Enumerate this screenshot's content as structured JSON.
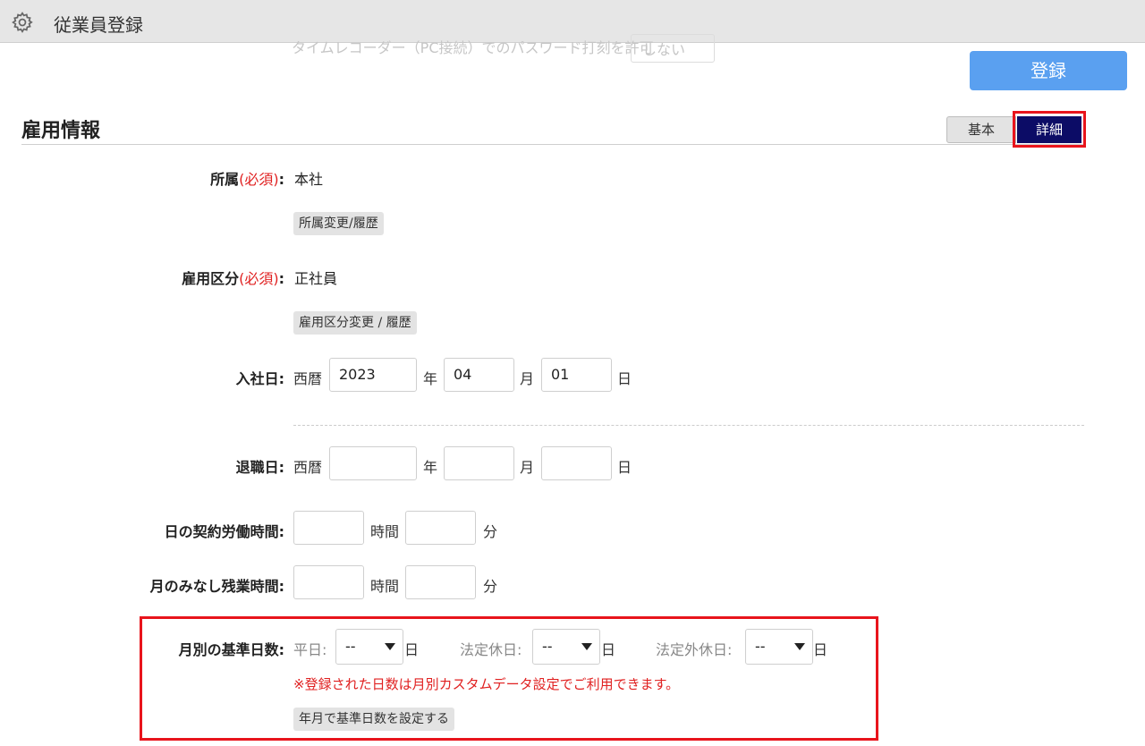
{
  "header": {
    "title": "従業員登録",
    "icon": "gear-icon"
  },
  "ghost_row": {
    "label": "タイムレコーダー（PC接続）でのパスワード打刻を許可",
    "value": "しない"
  },
  "toolbar": {
    "register_label": "登録"
  },
  "section": {
    "title": "雇用情報"
  },
  "view_toggle": {
    "basic": "基本",
    "detail": "詳細",
    "active": "detail"
  },
  "fields": {
    "affiliation": {
      "label": "所属",
      "required": "(必須)",
      "colon": ":",
      "value": "本社",
      "button": "所属変更/履歴"
    },
    "employment_type": {
      "label": "雇用区分",
      "required": "(必須)",
      "colon": ":",
      "value": "正社員",
      "button": "雇用区分変更 / 履歴"
    },
    "hire_date": {
      "label": "入社日:",
      "era": "西暦",
      "year": "2023",
      "year_unit": "年",
      "month": "04",
      "month_unit": "月",
      "day": "01",
      "day_unit": "日"
    },
    "retire_date": {
      "label": "退職日:",
      "era": "西暦",
      "year": "",
      "year_unit": "年",
      "month": "",
      "month_unit": "月",
      "day": "",
      "day_unit": "日"
    },
    "daily_hours": {
      "label": "日の契約労働時間:",
      "hours": "",
      "hours_unit": "時間",
      "minutes": "",
      "minutes_unit": "分"
    },
    "overtime": {
      "label": "月のみなし残業時間:",
      "hours": "",
      "hours_unit": "時間",
      "minutes": "",
      "minutes_unit": "分"
    },
    "monthly_days": {
      "label": "月別の基準日数:",
      "weekday_label": "平日:",
      "weekday_value": "--",
      "weekday_unit": "日",
      "legal_holiday_label": "法定休日:",
      "legal_holiday_value": "--",
      "legal_holiday_unit": "日",
      "non_legal_holiday_label": "法定外休日:",
      "non_legal_holiday_value": "--",
      "non_legal_holiday_unit": "日",
      "note": "※登録された日数は月別カスタムデータ設定でご利用できます。",
      "button": "年月で基準日数を設定する"
    }
  },
  "colors": {
    "primary": "#5aa0f0",
    "active_tab": "#0c0c66",
    "highlight": "#e8141c",
    "required": "#e02020"
  }
}
